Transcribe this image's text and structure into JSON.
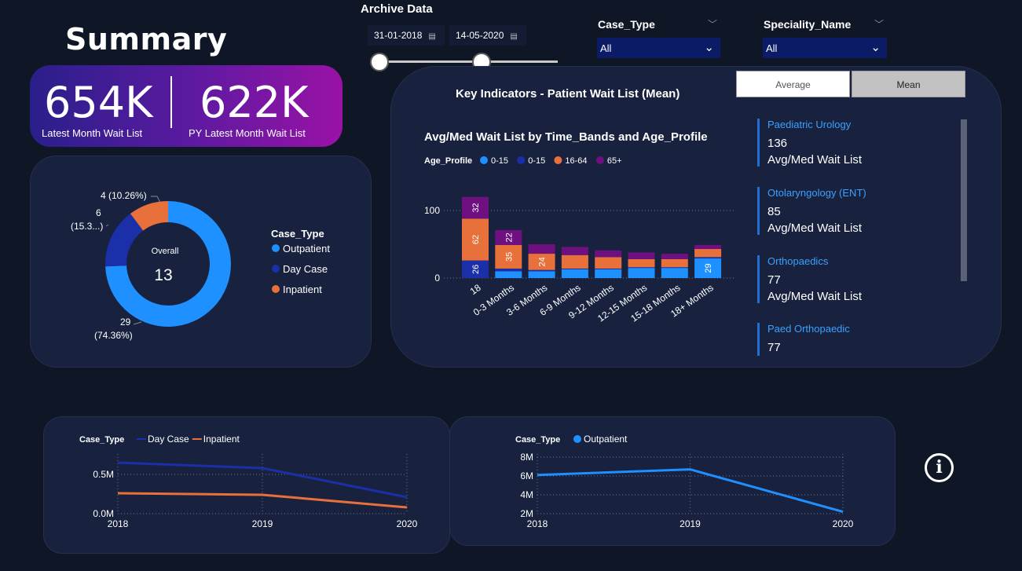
{
  "header": {
    "title": "Summary"
  },
  "kpis": [
    {
      "value": "654K",
      "label": "Latest Month Wait List"
    },
    {
      "value": "622K",
      "label": "PY Latest Month Wait List"
    }
  ],
  "archive": {
    "title": "Archive Data",
    "start_date": "31-01-2018",
    "end_date": "14-05-2020",
    "calendar_icon": "calendar-icon",
    "range_start_fraction": 0.0,
    "range_end_fraction": 0.72
  },
  "slicers": {
    "case_type": {
      "title": "Case_Type",
      "value": "All"
    },
    "speciality": {
      "title": "Speciality_Name",
      "value": "All"
    }
  },
  "donut": {
    "center_label": "Overall",
    "center_value": "13",
    "legend_title": "Case_Type",
    "label_inpatient": "4 (10.26%)",
    "label_daycase_1": "6",
    "label_daycase_2": "(15.3...)",
    "label_outpatient_1": "29",
    "label_outpatient_2": "(74.36%)"
  },
  "key_indicators": {
    "title": "Key Indicators - Patient Wait List (Mean)",
    "buttons": {
      "average": "Average",
      "mean": "Mean"
    },
    "bar_title": "Avg/Med Wait List by Time_Bands and Age_Profile",
    "legend_title": "Age_Profile",
    "specialities": [
      {
        "name": "Paediatric Urology",
        "value": "136",
        "label": "Avg/Med Wait List"
      },
      {
        "name": "Otolaryngology (ENT)",
        "value": "85",
        "label": "Avg/Med Wait List"
      },
      {
        "name": "Orthopaedics",
        "value": "77",
        "label": "Avg/Med Wait List"
      },
      {
        "name": "Paed Orthopaedic",
        "value": "77",
        "label": ""
      }
    ]
  },
  "info_icon": "info-icon",
  "chart_data": [
    {
      "type": "pie",
      "subtype": "donut",
      "legend_title": "Case_Type",
      "categories": [
        "Outpatient",
        "Day Case",
        "Inpatient"
      ],
      "values": [
        29,
        6,
        4
      ],
      "percent_labels": [
        "74.36%",
        "15.3...",
        "10.26%"
      ],
      "colors": [
        "#1e90ff",
        "#1a2fa8",
        "#e8703a"
      ],
      "legend_position": "right"
    },
    {
      "type": "bar",
      "stacked": true,
      "title": "Avg/Med Wait List by Time_Bands and Age_Profile",
      "legend_title": "Age_Profile",
      "legend_position": "top-left",
      "categories": [
        "18",
        "0-3 Months",
        "3-6 Months",
        "6-9 Months",
        "9-12 Months",
        "12-15 Months",
        "15-18 Months",
        "18+ Months"
      ],
      "ytick_labels": [
        "0",
        "100"
      ],
      "ylim": [
        0,
        120
      ],
      "series": [
        {
          "name": "0-15",
          "color": "#1e90ff",
          "values": [
            0,
            10,
            10,
            13,
            13,
            15,
            15,
            29
          ]
        },
        {
          "name": "0-15",
          "color": "#1a2fa8",
          "values": [
            26,
            4,
            2,
            1,
            1,
            1,
            1,
            2
          ]
        },
        {
          "name": "16-64",
          "color": "#e8703a",
          "values": [
            62,
            35,
            24,
            20,
            17,
            12,
            12,
            12
          ]
        },
        {
          "name": "65+",
          "color": "#6e1080",
          "values": [
            32,
            22,
            14,
            12,
            10,
            10,
            8,
            6
          ]
        }
      ],
      "data_labels": [
        {
          "category": "18",
          "series": 1,
          "text": "26",
          "rotated": true
        },
        {
          "category": "18",
          "series": 2,
          "text": "62",
          "rotated": true
        },
        {
          "category": "18",
          "series": 3,
          "text": "32",
          "rotated": true
        },
        {
          "category": "0-3 Months",
          "series": 2,
          "text": "35",
          "rotated": true
        },
        {
          "category": "0-3 Months",
          "series": 3,
          "text": "22",
          "rotated": true
        },
        {
          "category": "3-6 Months",
          "series": 2,
          "text": "24",
          "rotated": true
        },
        {
          "category": "18+ Months",
          "series": 0,
          "text": "29",
          "rotated": true
        }
      ],
      "grid": true
    },
    {
      "type": "line",
      "legend_title": "Case_Type",
      "legend_position": "top-left",
      "x": [
        "2018",
        "2019",
        "2020"
      ],
      "ytick_labels": [
        "0.0M",
        "0.5M"
      ],
      "ylim": [
        0,
        0.72
      ],
      "series": [
        {
          "name": "Day Case",
          "color": "#1a2fa8",
          "values": [
            0.65,
            0.58,
            0.21
          ]
        },
        {
          "name": "Inpatient",
          "color": "#e8703a",
          "values": [
            0.26,
            0.24,
            0.08
          ]
        }
      ],
      "grid": true
    },
    {
      "type": "line",
      "legend_title": "Case_Type",
      "legend_position": "top-left",
      "x": [
        "2018",
        "2019",
        "2020"
      ],
      "ytick_labels": [
        "2M",
        "4M",
        "6M",
        "8M"
      ],
      "ylim": [
        2,
        8
      ],
      "series": [
        {
          "name": "Outpatient",
          "color": "#1e90ff",
          "values": [
            6.1,
            6.7,
            2.2
          ]
        }
      ],
      "grid": true
    }
  ]
}
